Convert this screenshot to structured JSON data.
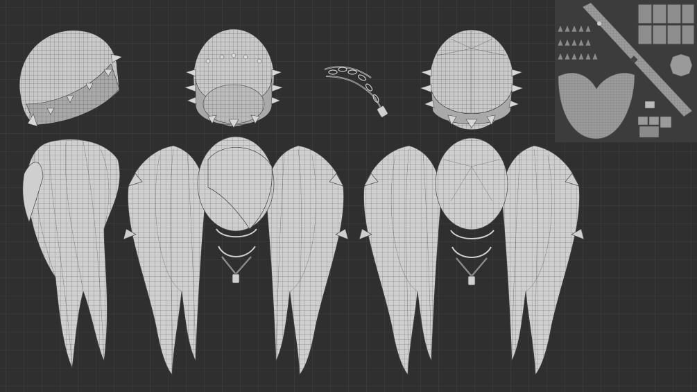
{
  "viewport": {
    "background": "#2f2f2f",
    "grid_color": "#3a3a3a",
    "mesh_color": "#c9c9c9",
    "wire_color": "#555555"
  },
  "objects": [
    {
      "name": "beanie-side-view"
    },
    {
      "name": "beanie-front-view"
    },
    {
      "name": "chain-detail"
    },
    {
      "name": "beanie-back-view"
    },
    {
      "name": "uv-layout-panel"
    },
    {
      "name": "hair-side-view"
    },
    {
      "name": "hair-front-view"
    },
    {
      "name": "hair-back-view"
    }
  ]
}
